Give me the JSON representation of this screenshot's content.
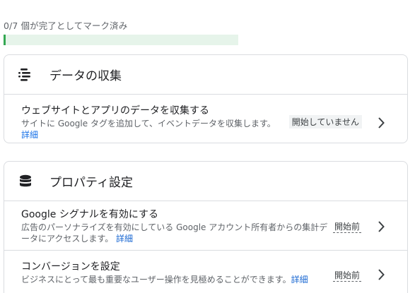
{
  "progress": {
    "label": "0/7 個が完了としてマーク済み",
    "completed": 0,
    "total": 7
  },
  "colors": {
    "progress_fill": "#34a853",
    "progress_track": "#e6f4ea",
    "link": "#1a73e8"
  },
  "sections": {
    "data_collection": {
      "icon": "data-streams-icon",
      "title": "データの収集",
      "tasks": [
        {
          "title": "ウェブサイトとアプリのデータを収集する",
          "description": "サイトに Google タグを追加して、イベントデータを収集します。",
          "link": "詳細",
          "status": "開始していません"
        }
      ]
    },
    "property_settings": {
      "icon": "database-icon",
      "title": "プロパティ設定",
      "tasks": [
        {
          "title": "Google シグナルを有効にする",
          "description": "広告のパーソナライズを有効にしている Google アカウント所有者からの集計データにアクセスします。",
          "link": "詳細",
          "status": "開始前"
        },
        {
          "title": "コンバージョンを設定",
          "description": "ビジネスにとって最も重要なユーザー操作を見極めることができます。",
          "link": "詳細",
          "status": "開始前"
        }
      ]
    }
  }
}
